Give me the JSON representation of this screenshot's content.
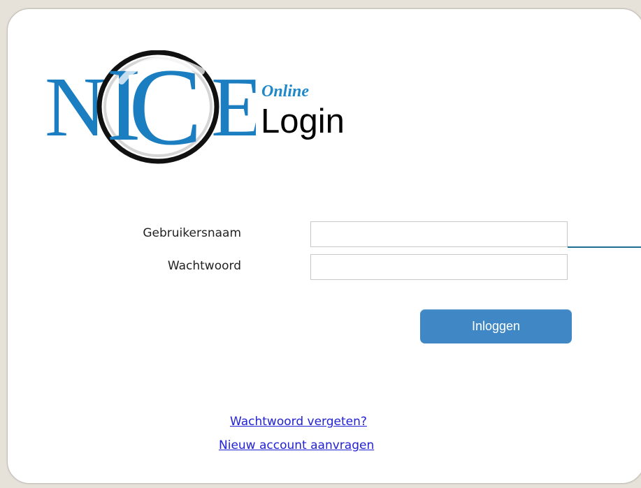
{
  "logo": {
    "brand_text": "NICE",
    "subtitle": "Online",
    "title": "Login"
  },
  "form": {
    "username_label": "Gebruikersnaam",
    "username_value": "",
    "password_label": "Wachtwoord",
    "password_value": "",
    "submit_label": "Inloggen"
  },
  "links": {
    "forgot_password": "Wachtwoord vergeten?",
    "new_account": "Nieuw account aanvragen"
  },
  "colors": {
    "brand_blue": "#1f88c9",
    "button_blue": "#3f88c5",
    "link_blue": "#2121d6",
    "background": "#e6e2da"
  }
}
